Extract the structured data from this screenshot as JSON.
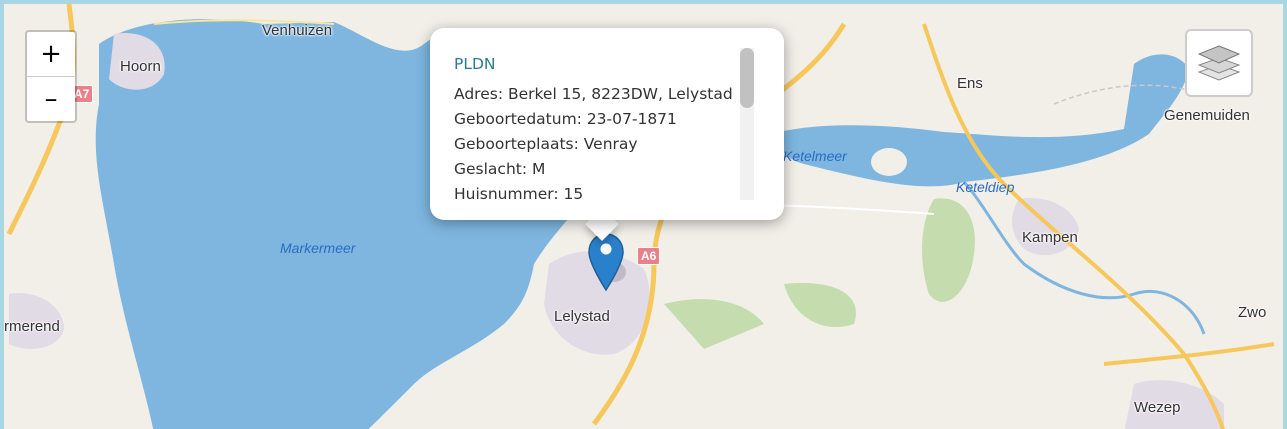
{
  "map": {
    "labels": {
      "venhuizen": "Venhuizen",
      "hoorn": "Hoorn",
      "markermeer": "Markermeer",
      "purmerend": "rmerend",
      "lelystad": "Lelystad",
      "ketelmeer": "Ketelmeer",
      "keteldiep": "Keteldiep",
      "ens": "Ens",
      "genemuiden": "Genemuiden",
      "kampen": "Kampen",
      "zwolle": "Zwo",
      "wezep": "Wezep"
    },
    "road_shields": {
      "a7": "A7",
      "a6": "A6"
    },
    "colors": {
      "water": "#7eb6e0",
      "land": "#f2efe9",
      "urban": "#e1dbe6",
      "forest": "#c4dcae",
      "road": "#f6c75a",
      "accent": "#2a7b8f",
      "marker": "#2a81cb"
    }
  },
  "controls": {
    "zoom_in": "+",
    "zoom_out": "–",
    "layers_icon": "layers-icon"
  },
  "popup": {
    "title": "PLDN",
    "lines": [
      "Adres: Berkel 15, 8223DW, Lelystad",
      "Geboortedatum: 23-07-1871",
      "Geboorteplaats: Venray",
      "Geslacht: M",
      "Huisnummer: 15"
    ]
  }
}
